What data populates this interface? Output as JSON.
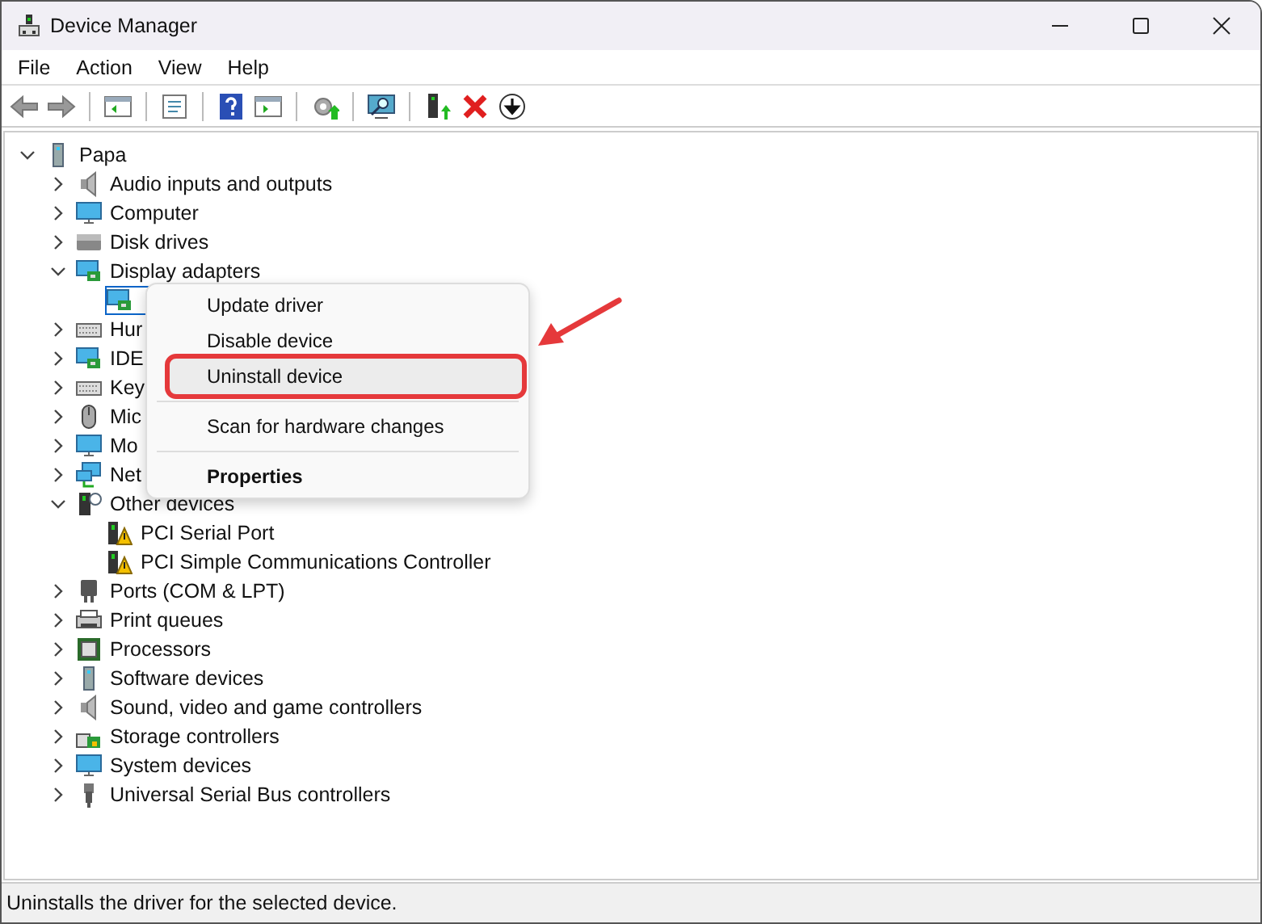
{
  "window": {
    "title": "Device Manager"
  },
  "menu_bar": [
    "File",
    "Action",
    "View",
    "Help"
  ],
  "tree": {
    "label": "Papa",
    "kind": "group",
    "expanded": true,
    "selected": false,
    "children": [
      {
        "label": "Audio inputs and outputs",
        "kind": "group",
        "expanded": false,
        "selected": false
      },
      {
        "label": "Computer",
        "kind": "group",
        "expanded": false,
        "selected": false
      },
      {
        "label": "Disk drives",
        "kind": "group",
        "expanded": false,
        "selected": false
      },
      {
        "label": "Display adapters",
        "kind": "group",
        "expanded": true,
        "selected": false,
        "children": [
          {
            "kind": "device",
            "selected": true
          }
        ]
      },
      {
        "label": "Hur",
        "kind": "group",
        "expanded": false,
        "selected": false
      },
      {
        "label": "IDE",
        "kind": "group",
        "expanded": false,
        "selected": false
      },
      {
        "label": "Key",
        "kind": "group",
        "expanded": false,
        "selected": false
      },
      {
        "label": "Mic",
        "kind": "group",
        "expanded": false,
        "selected": false
      },
      {
        "label": "Mo",
        "kind": "group",
        "expanded": false,
        "selected": false
      },
      {
        "label": "Net",
        "kind": "group",
        "expanded": false,
        "selected": false
      },
      {
        "label": "Other devices",
        "kind": "group",
        "expanded": true,
        "selected": false,
        "children": [
          {
            "label": "PCI Serial Port",
            "kind": "device",
            "selected": false
          },
          {
            "label": "PCI Simple Communications Controller",
            "kind": "device",
            "selected": false
          }
        ]
      },
      {
        "label": "Ports (COM & LPT)",
        "kind": "group",
        "expanded": false,
        "selected": false
      },
      {
        "label": "Print queues",
        "kind": "group",
        "expanded": false,
        "selected": false
      },
      {
        "label": "Processors",
        "kind": "group",
        "expanded": false,
        "selected": false
      },
      {
        "label": "Software devices",
        "kind": "group",
        "expanded": false,
        "selected": false
      },
      {
        "label": "Sound, video and game controllers",
        "kind": "group",
        "expanded": false,
        "selected": false
      },
      {
        "label": "Storage controllers",
        "kind": "group",
        "expanded": false,
        "selected": false
      },
      {
        "label": "System devices",
        "kind": "group",
        "expanded": false,
        "selected": false
      },
      {
        "label": "Universal Serial Bus controllers",
        "kind": "group",
        "expanded": false,
        "selected": false
      }
    ]
  },
  "context_menu": [
    {
      "kind": "item",
      "label": "Update driver",
      "selected": false,
      "annotated": false,
      "default": false
    },
    {
      "kind": "item",
      "label": "Disable device",
      "selected": false,
      "annotated": false,
      "default": false
    },
    {
      "kind": "item",
      "label": "Uninstall device",
      "selected": true,
      "annotated": true,
      "default": false
    },
    {
      "kind": "separator"
    },
    {
      "kind": "item",
      "label": "Scan for hardware changes",
      "selected": false,
      "annotated": false,
      "default": false
    },
    {
      "kind": "separator"
    },
    {
      "kind": "item",
      "label": "Properties",
      "selected": false,
      "annotated": false,
      "default": true
    }
  ],
  "status_bar": "Uninstalls the driver for the selected device."
}
